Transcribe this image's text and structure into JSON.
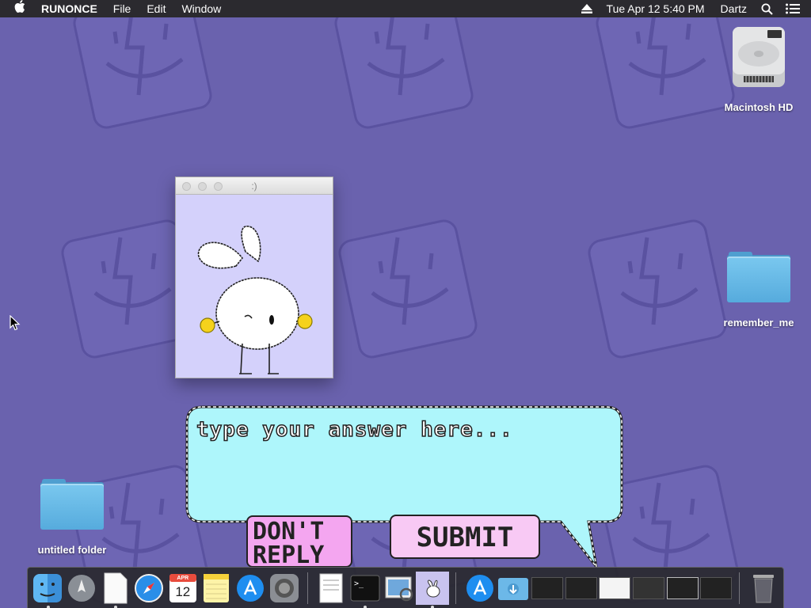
{
  "menubar": {
    "app_name": "RUNONCE",
    "menus": [
      "File",
      "Edit",
      "Window"
    ],
    "datetime": "Tue Apr 12  5:40 PM",
    "user": "Dartz"
  },
  "desktop": {
    "icons": [
      {
        "label": "Macintosh HD",
        "icon": "hard-drive-icon"
      },
      {
        "label": "remember_me",
        "icon": "folder-icon"
      },
      {
        "label": "untitled folder",
        "icon": "folder-icon"
      }
    ]
  },
  "mini_window": {
    "title": ":)"
  },
  "bubble": {
    "placeholder": "type your answer here...",
    "dont_reply_label": "DON'T REPLY",
    "submit_label": "SUBMIT"
  },
  "dock": {
    "calendar_month": "APR",
    "calendar_day": "12",
    "apps": [
      "finder-icon",
      "launchpad-icon",
      "textedit-doc-icon",
      "safari-icon",
      "calendar-icon",
      "notes-icon",
      "app-store-icon",
      "system-preferences-icon",
      "textedit-icon",
      "terminal-icon",
      "preview-icon",
      "runonce-bunny-icon",
      "app-store-icon",
      "downloads-folder-icon",
      "window-thumbnail",
      "window-thumbnail",
      "window-thumbnail",
      "window-thumbnail",
      "window-thumbnail",
      "window-thumbnail",
      "trash-icon"
    ]
  },
  "colors": {
    "wallpaper": "#6a62ae",
    "bubble_fill": "#aef6fb",
    "button_pink": "#f4a6f0",
    "window_bg": "#d4d1fb"
  }
}
